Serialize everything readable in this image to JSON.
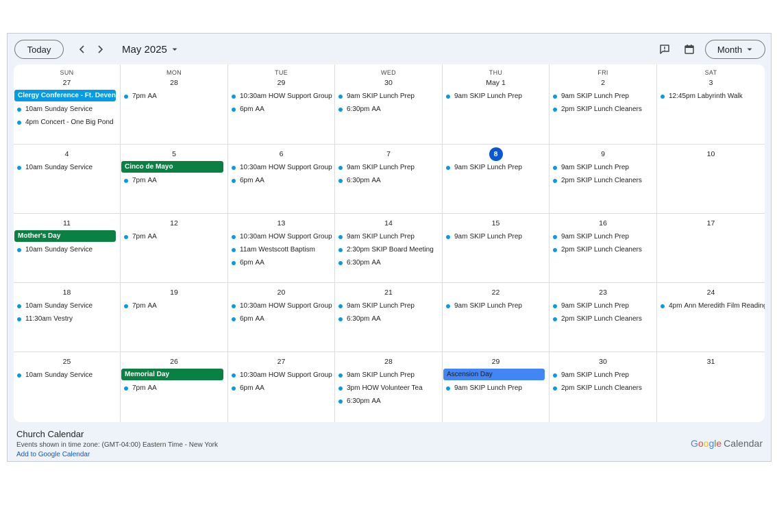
{
  "toolbar": {
    "today_label": "Today",
    "month_title": "May 2025",
    "view_label": "Month"
  },
  "icons": {
    "prev": "chevron-left-icon",
    "next": "chevron-right-icon",
    "dropdown": "caret-down-icon",
    "feedback": "feedback-icon",
    "calendar": "calendar-icon"
  },
  "colors": {
    "event_dot": "#039be5",
    "blue_event": "#039be5",
    "green_event": "#0b8043",
    "ascension_event": "#4285f4",
    "today_circle": "#0b57d0"
  },
  "weekdays": [
    "SUN",
    "MON",
    "TUE",
    "WED",
    "THU",
    "FRI",
    "SAT"
  ],
  "weeks": [
    [
      {
        "date": "27",
        "allday": [
          {
            "title": "Clergy Conference - Ft. Devens, MA",
            "color": "#039be5"
          }
        ],
        "events": [
          {
            "time": "10am",
            "title": "Sunday Service"
          },
          {
            "time": "4pm",
            "title": "Concert - One Big Pond"
          }
        ]
      },
      {
        "date": "28",
        "events": [
          {
            "time": "7pm",
            "title": "AA"
          }
        ]
      },
      {
        "date": "29",
        "events": [
          {
            "time": "10:30am",
            "title": "HOW Support Group"
          },
          {
            "time": "6pm",
            "title": "AA"
          }
        ]
      },
      {
        "date": "30",
        "events": [
          {
            "time": "9am",
            "title": "SKIP Lunch Prep"
          },
          {
            "time": "6:30pm",
            "title": "AA"
          }
        ]
      },
      {
        "date": "May 1",
        "events": [
          {
            "time": "9am",
            "title": "SKIP Lunch Prep"
          }
        ]
      },
      {
        "date": "2",
        "events": [
          {
            "time": "9am",
            "title": "SKIP Lunch Prep"
          },
          {
            "time": "2pm",
            "title": "SKIP Lunch Cleaners"
          }
        ]
      },
      {
        "date": "3",
        "events": [
          {
            "time": "12:45pm",
            "title": "Labyrinth Walk"
          }
        ]
      }
    ],
    [
      {
        "date": "4",
        "events": [
          {
            "time": "10am",
            "title": "Sunday Service"
          }
        ]
      },
      {
        "date": "5",
        "allday": [
          {
            "title": "Cinco de Mayo",
            "color": "#0b8043"
          }
        ],
        "events": [
          {
            "time": "7pm",
            "title": "AA"
          }
        ]
      },
      {
        "date": "6",
        "events": [
          {
            "time": "10:30am",
            "title": "HOW Support Group"
          },
          {
            "time": "6pm",
            "title": "AA"
          }
        ]
      },
      {
        "date": "7",
        "events": [
          {
            "time": "9am",
            "title": "SKIP Lunch Prep"
          },
          {
            "time": "6:30pm",
            "title": "AA"
          }
        ]
      },
      {
        "date": "8",
        "today": true,
        "events": [
          {
            "time": "9am",
            "title": "SKIP Lunch Prep"
          }
        ]
      },
      {
        "date": "9",
        "events": [
          {
            "time": "9am",
            "title": "SKIP Lunch Prep"
          },
          {
            "time": "2pm",
            "title": "SKIP Lunch Cleaners"
          }
        ]
      },
      {
        "date": "10",
        "events": []
      }
    ],
    [
      {
        "date": "11",
        "allday": [
          {
            "title": "Mother's Day",
            "color": "#0b8043"
          }
        ],
        "events": [
          {
            "time": "10am",
            "title": "Sunday Service"
          }
        ]
      },
      {
        "date": "12",
        "events": [
          {
            "time": "7pm",
            "title": "AA"
          }
        ]
      },
      {
        "date": "13",
        "events": [
          {
            "time": "10:30am",
            "title": "HOW Support Group"
          },
          {
            "time": "11am",
            "title": "Westscott Baptism"
          },
          {
            "time": "6pm",
            "title": "AA"
          }
        ]
      },
      {
        "date": "14",
        "events": [
          {
            "time": "9am",
            "title": "SKIP Lunch Prep"
          },
          {
            "time": "2:30pm",
            "title": "SKIP Board Meeting"
          },
          {
            "time": "6:30pm",
            "title": "AA"
          }
        ]
      },
      {
        "date": "15",
        "events": [
          {
            "time": "9am",
            "title": "SKIP Lunch Prep"
          }
        ]
      },
      {
        "date": "16",
        "events": [
          {
            "time": "9am",
            "title": "SKIP Lunch Prep"
          },
          {
            "time": "2pm",
            "title": "SKIP Lunch Cleaners"
          }
        ]
      },
      {
        "date": "17",
        "events": []
      }
    ],
    [
      {
        "date": "18",
        "events": [
          {
            "time": "10am",
            "title": "Sunday Service"
          },
          {
            "time": "11:30am",
            "title": "Vestry"
          }
        ]
      },
      {
        "date": "19",
        "events": [
          {
            "time": "7pm",
            "title": "AA"
          }
        ]
      },
      {
        "date": "20",
        "events": [
          {
            "time": "10:30am",
            "title": "HOW Support Group"
          },
          {
            "time": "6pm",
            "title": "AA"
          }
        ]
      },
      {
        "date": "21",
        "events": [
          {
            "time": "9am",
            "title": "SKIP Lunch Prep"
          },
          {
            "time": "6:30pm",
            "title": "AA"
          }
        ]
      },
      {
        "date": "22",
        "events": [
          {
            "time": "9am",
            "title": "SKIP Lunch Prep"
          }
        ]
      },
      {
        "date": "23",
        "events": [
          {
            "time": "9am",
            "title": "SKIP Lunch Prep"
          },
          {
            "time": "2pm",
            "title": "SKIP Lunch Cleaners"
          }
        ]
      },
      {
        "date": "24",
        "events": [
          {
            "time": "4pm",
            "title": "Ann Meredith Film Reading"
          }
        ]
      }
    ],
    [
      {
        "date": "25",
        "events": [
          {
            "time": "10am",
            "title": "Sunday Service"
          }
        ]
      },
      {
        "date": "26",
        "allday": [
          {
            "title": "Memorial Day",
            "color": "#0b8043"
          }
        ],
        "events": [
          {
            "time": "7pm",
            "title": "AA"
          }
        ]
      },
      {
        "date": "27",
        "events": [
          {
            "time": "10:30am",
            "title": "HOW Support Group"
          },
          {
            "time": "6pm",
            "title": "AA"
          }
        ]
      },
      {
        "date": "28",
        "events": [
          {
            "time": "9am",
            "title": "SKIP Lunch Prep"
          },
          {
            "time": "3pm",
            "title": "HOW Volunteer Tea"
          },
          {
            "time": "6:30pm",
            "title": "AA"
          }
        ]
      },
      {
        "date": "29",
        "allday": [
          {
            "title": "Ascension Day",
            "color": "#4285f4",
            "text_color": "#1f1f1f"
          }
        ],
        "events": [
          {
            "time": "9am",
            "title": "SKIP Lunch Prep"
          }
        ]
      },
      {
        "date": "30",
        "events": [
          {
            "time": "9am",
            "title": "SKIP Lunch Prep"
          },
          {
            "time": "2pm",
            "title": "SKIP Lunch Cleaners"
          }
        ]
      },
      {
        "date": "31",
        "events": []
      }
    ]
  ],
  "footer": {
    "calendar_name": "Church Calendar",
    "timezone_note": "Events shown in time zone: (GMT-04:00) Eastern Time - New York",
    "add_link": "Add to Google Calendar",
    "brand_google": "Google",
    "brand_calendar": "Calendar"
  }
}
